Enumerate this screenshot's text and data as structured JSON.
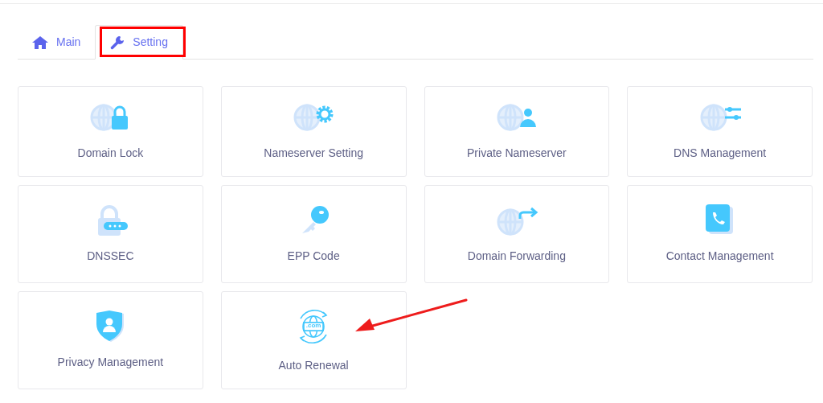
{
  "tabs": [
    {
      "label": "Main",
      "kind": "home",
      "selected": false,
      "highlighted": false
    },
    {
      "label": "Setting",
      "kind": "wrench",
      "selected": true,
      "highlighted": true
    }
  ],
  "cards": [
    {
      "label": "Domain Lock",
      "kind": "globe-lock"
    },
    {
      "label": "Nameserver Setting",
      "kind": "globe-gear"
    },
    {
      "label": "Private Nameserver",
      "kind": "globe-user"
    },
    {
      "label": "DNS Management",
      "kind": "globe-sliders"
    },
    {
      "label": "DNSSEC",
      "kind": "lock-dots"
    },
    {
      "label": "EPP Code",
      "kind": "key"
    },
    {
      "label": "Domain Forwarding",
      "kind": "globe-forward"
    },
    {
      "label": "Contact Management",
      "kind": "phone"
    },
    {
      "label": "Privacy Management",
      "kind": "shield-user"
    },
    {
      "label": "Auto Renewal",
      "kind": "globe-renew",
      "badge": ".com"
    }
  ],
  "annotation": {
    "arrow_shown": true
  }
}
